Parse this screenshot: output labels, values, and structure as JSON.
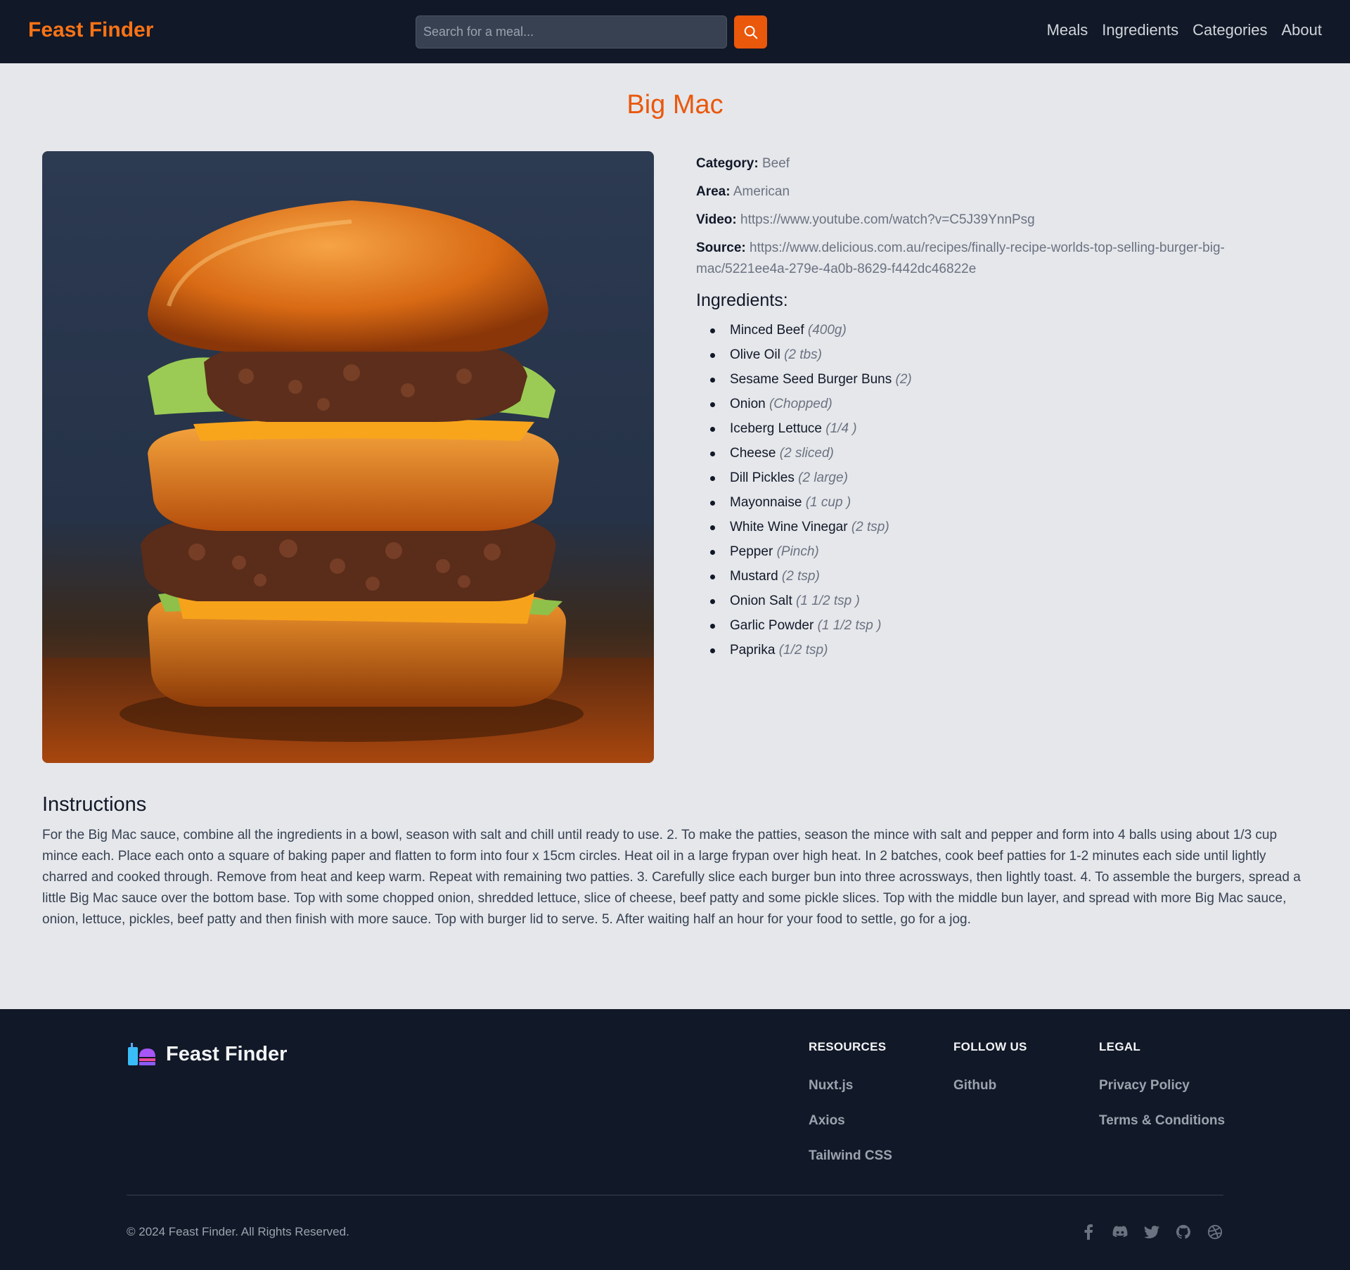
{
  "header": {
    "brand": "Feast Finder",
    "search": {
      "placeholder": "Search for a meal...",
      "value": ""
    },
    "nav": [
      "Meals",
      "Ingredients",
      "Categories",
      "About"
    ]
  },
  "meal": {
    "title": "Big Mac",
    "category_label": "Category:",
    "category": "Beef",
    "area_label": "Area:",
    "area": "American",
    "video_label": "Video:",
    "video": "https://www.youtube.com/watch?v=C5J39YnnPsg",
    "source_label": "Source:",
    "source": "https://www.delicious.com.au/recipes/finally-recipe-worlds-top-selling-burger-big-mac/5221ee4a-279e-4a0b-8629-f442dc46822e",
    "ingredients_title": "Ingredients:",
    "ingredients": [
      {
        "name": "Minced Beef",
        "measure": "(400g)"
      },
      {
        "name": "Olive Oil",
        "measure": "(2 tbs)"
      },
      {
        "name": "Sesame Seed Burger Buns",
        "measure": "(2)"
      },
      {
        "name": "Onion",
        "measure": "(Chopped)"
      },
      {
        "name": "Iceberg Lettuce",
        "measure": "(1/4 )"
      },
      {
        "name": "Cheese",
        "measure": "(2 sliced)"
      },
      {
        "name": "Dill Pickles",
        "measure": "(2 large)"
      },
      {
        "name": "Mayonnaise",
        "measure": "(1 cup )"
      },
      {
        "name": "White Wine Vinegar",
        "measure": "(2 tsp)"
      },
      {
        "name": "Pepper",
        "measure": "(Pinch)"
      },
      {
        "name": "Mustard",
        "measure": "(2 tsp)"
      },
      {
        "name": "Onion Salt",
        "measure": "(1 1/2 tsp )"
      },
      {
        "name": "Garlic Powder",
        "measure": "(1 1/2 tsp )"
      },
      {
        "name": "Paprika",
        "measure": "(1/2 tsp)"
      }
    ],
    "instructions_title": "Instructions",
    "instructions": "For the Big Mac sauce, combine all the ingredients in a bowl, season with salt and chill until ready to use. 2. To make the patties, season the mince with salt and pepper and form into 4 balls using about 1/3 cup mince each. Place each onto a square of baking paper and flatten to form into four x 15cm circles. Heat oil in a large frypan over high heat. In 2 batches, cook beef patties for 1-2 minutes each side until lightly charred and cooked through. Remove from heat and keep warm. Repeat with remaining two patties. 3. Carefully slice each burger bun into three acrossways, then lightly toast. 4. To assemble the burgers, spread a little Big Mac sauce over the bottom base. Top with some chopped onion, shredded lettuce, slice of cheese, beef patty and some pickle slices. Top with the middle bun layer, and spread with more Big Mac sauce, onion, lettuce, pickles, beef patty and then finish with more sauce. Top with burger lid to serve. 5. After waiting half an hour for your food to settle, go for a jog."
  },
  "footer": {
    "brand": "Feast Finder",
    "columns": [
      {
        "title": "RESOURCES",
        "links": [
          "Nuxt.js",
          "Axios",
          "Tailwind CSS"
        ]
      },
      {
        "title": "FOLLOW US",
        "links": [
          "Github"
        ]
      },
      {
        "title": "LEGAL",
        "links": [
          "Privacy Policy",
          "Terms & Conditions"
        ]
      }
    ],
    "copyright": "© 2024 Feast Finder. All Rights Reserved.",
    "social_icons": [
      "facebook-icon",
      "discord-icon",
      "twitter-icon",
      "github-icon",
      "dribbble-icon"
    ]
  },
  "colors": {
    "accent": "#ea580c",
    "brand": "#f97316",
    "header_bg": "#111827",
    "page_bg": "#e5e7eb"
  }
}
